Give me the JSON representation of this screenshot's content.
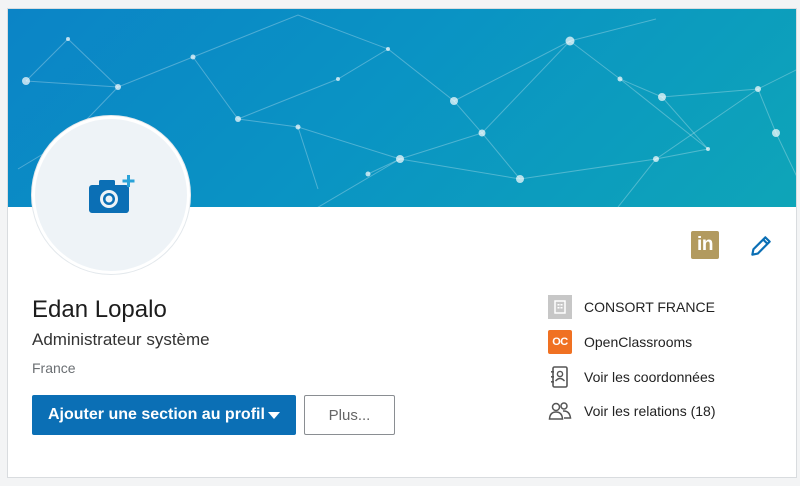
{
  "profile": {
    "name": "Edan Lopalo",
    "headline": "Administrateur système",
    "location": "France"
  },
  "actions": {
    "add_section_label": "Ajouter une section au profil",
    "more_label": "Plus..."
  },
  "sidebar": {
    "items": [
      {
        "label": "CONSORT FRANCE",
        "icon": "company-building-icon"
      },
      {
        "label": "OpenClassrooms",
        "icon": "openclassrooms-logo",
        "logo_text": "OC"
      },
      {
        "label": "Voir les coordonnées",
        "icon": "contact-card-icon"
      },
      {
        "label": "Voir les relations (18)",
        "icon": "people-icon"
      }
    ]
  },
  "header_icons": {
    "linkedin_badge": "in",
    "edit": "pencil-icon",
    "photo": "camera-add-icon"
  },
  "colors": {
    "primary": "#0b6fb5",
    "linkedin_badge": "#b29a5f",
    "banner_start": "#0b84c6",
    "banner_end": "#0ea5b8",
    "openclassrooms": "#f07122"
  }
}
